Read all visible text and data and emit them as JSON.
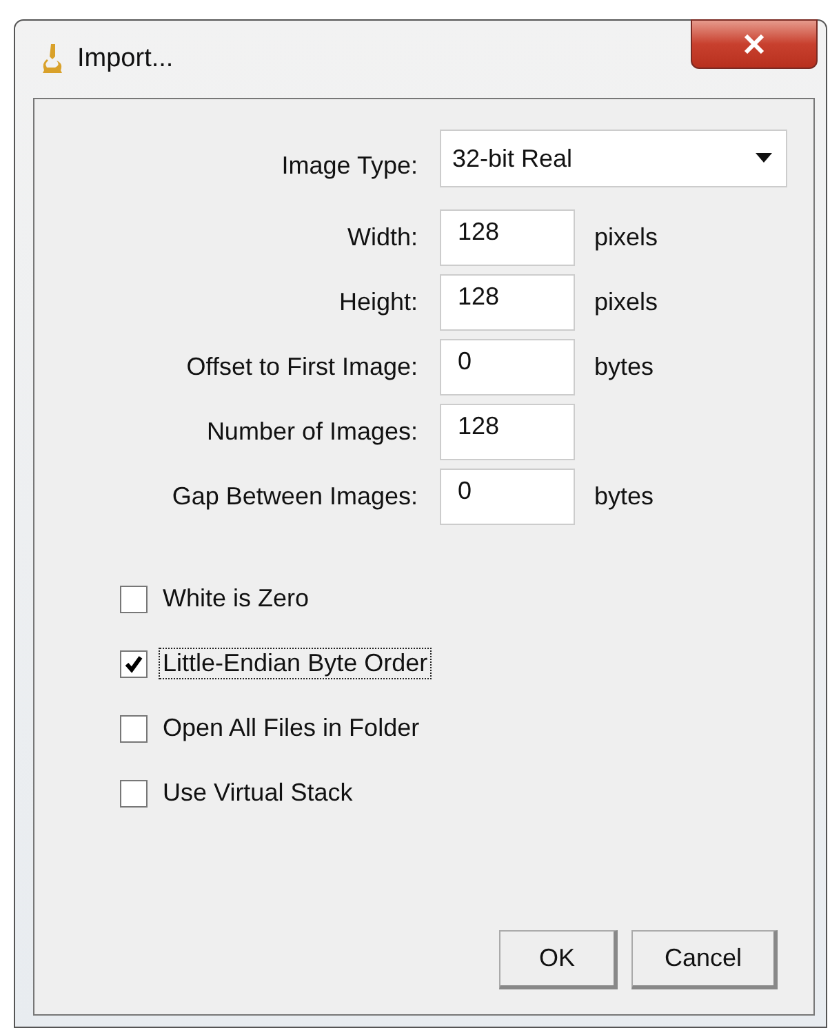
{
  "window": {
    "title": "Import..."
  },
  "fields": [
    {
      "kind": "dropdown",
      "label": "Image Type:",
      "value": "32-bit Real"
    },
    {
      "kind": "text",
      "label": "Width:",
      "value": "128",
      "unit": "pixels"
    },
    {
      "kind": "text",
      "label": "Height:",
      "value": "128",
      "unit": "pixels"
    },
    {
      "kind": "text",
      "label": "Offset to First Image:",
      "value": "0",
      "unit": "bytes"
    },
    {
      "kind": "text",
      "label": "Number of Images:",
      "value": "128"
    },
    {
      "kind": "text",
      "label": "Gap Between Images:",
      "value": "0",
      "unit": "bytes"
    }
  ],
  "checkboxes": [
    {
      "label": "White is Zero",
      "checked": false,
      "focused": false
    },
    {
      "label": "Little-Endian Byte Order",
      "checked": true,
      "focused": true
    },
    {
      "label": "Open All Files in Folder",
      "checked": false,
      "focused": false
    },
    {
      "label": "Use Virtual Stack",
      "checked": false,
      "focused": false
    }
  ],
  "buttons": [
    "OK",
    "Cancel"
  ]
}
